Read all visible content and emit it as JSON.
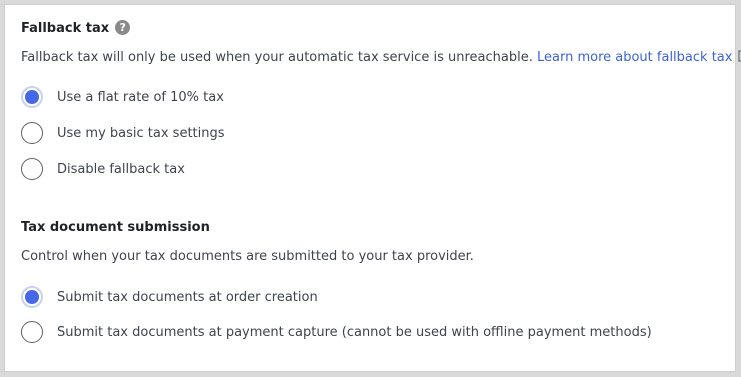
{
  "fallback": {
    "title": "Fallback tax",
    "help_icon": "question-circle-icon",
    "description": "Fallback tax will only be used when your automatic tax service is unreachable.",
    "link_text": "Learn more about fallback tax",
    "link_icon": "external-link-icon",
    "options": [
      {
        "label": "Use a flat rate of 10% tax",
        "checked": true
      },
      {
        "label": "Use my basic tax settings",
        "checked": false
      },
      {
        "label": "Disable fallback tax",
        "checked": false
      }
    ]
  },
  "submission": {
    "title": "Tax document submission",
    "description": "Control when your tax documents are submitted to your tax provider.",
    "options": [
      {
        "label": "Submit tax documents at order creation",
        "checked": true
      },
      {
        "label": "Submit tax documents at payment capture (cannot be used with offline payment methods)",
        "checked": false
      }
    ]
  },
  "colors": {
    "accent": "#4668e8",
    "link": "#3b63d6",
    "text": "#3e444d"
  }
}
